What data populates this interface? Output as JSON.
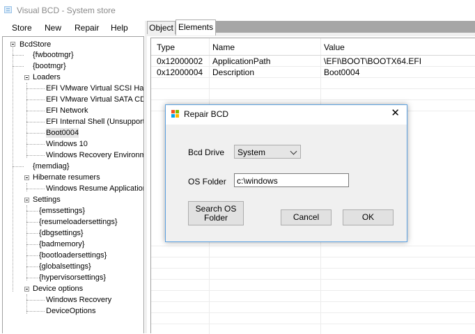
{
  "window": {
    "title": "Visual BCD - System store"
  },
  "menu": [
    "Store",
    "New",
    "Repair",
    "Help"
  ],
  "tree": {
    "root": "BcdStore",
    "items": [
      "{fwbootmgr}",
      "{bootmgr}",
      "Loaders",
      "EFI VMware Virtual SCSI Har",
      "EFI VMware Virtual SATA CD",
      "EFI Network",
      "EFI Internal Shell (Unsupporte",
      "Boot0004",
      "Windows 10",
      "Windows Recovery Environm",
      "{memdiag}",
      "Hibernate resumers",
      "Windows Resume Applicatior",
      "Settings",
      "{emssettings}",
      "{resumeloadersettings}",
      "{dbgsettings}",
      "{badmemory}",
      "{bootloadersettings}",
      "{globalsettings}",
      "{hypervisorsettings}",
      "Device options",
      "Windows Recovery",
      "DeviceOptions"
    ]
  },
  "tabs": [
    "Object",
    "Elements"
  ],
  "grid": {
    "columns": [
      "Type",
      "Name",
      "Value"
    ],
    "rows": [
      [
        "0x12000002",
        "ApplicationPath",
        "\\EFI\\BOOT\\BOOTX64.EFI"
      ],
      [
        "0x12000004",
        "Description",
        "Boot0004"
      ]
    ]
  },
  "dialog": {
    "title": "Repair BCD",
    "close": "✕",
    "bcd_drive_label": "Bcd Drive",
    "bcd_drive_value": "System",
    "os_folder_label": "OS Folder",
    "os_folder_value": "c:\\windows",
    "search_button": "Search OS Folder",
    "cancel_button": "Cancel",
    "ok_button": "OK"
  },
  "colors": {
    "accent": "#5aa0e0",
    "selection": "#e6e6e6",
    "tab_band": "#a6a6a6"
  }
}
